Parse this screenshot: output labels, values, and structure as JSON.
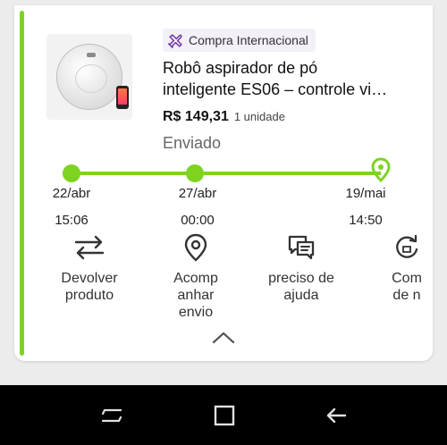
{
  "order": {
    "badge": "Compra Internacional",
    "title_line1": "Robô aspirador de pó",
    "title_line2": "inteligente ES06 – controle vi…",
    "price": "R$ 149,31",
    "quantity": "1 unidade",
    "status": "Enviado"
  },
  "timeline": [
    {
      "date": "22/abr",
      "time": "15:06"
    },
    {
      "date": "27/abr",
      "time": "00:00"
    },
    {
      "date": "19/mai",
      "time": "14:50"
    }
  ],
  "actions": [
    {
      "line1": "Devolver",
      "line2": "produto",
      "line3": "",
      "icon": "return-arrows-icon"
    },
    {
      "line1": "Acomp",
      "line2": "anhar",
      "line3": "envio",
      "icon": "location-pin-icon"
    },
    {
      "line1": "preciso de",
      "line2": "ajuda",
      "line3": "",
      "icon": "chat-bubbles-icon"
    },
    {
      "line1": "Com",
      "line2": "de n",
      "line3": "",
      "icon": "refresh-icon"
    }
  ],
  "colors": {
    "accent": "#7ed321",
    "badge_icon": "#6b2fa3",
    "navbar": "#000000"
  },
  "navigation": [
    "recent-apps-icon",
    "home-icon",
    "back-icon"
  ]
}
